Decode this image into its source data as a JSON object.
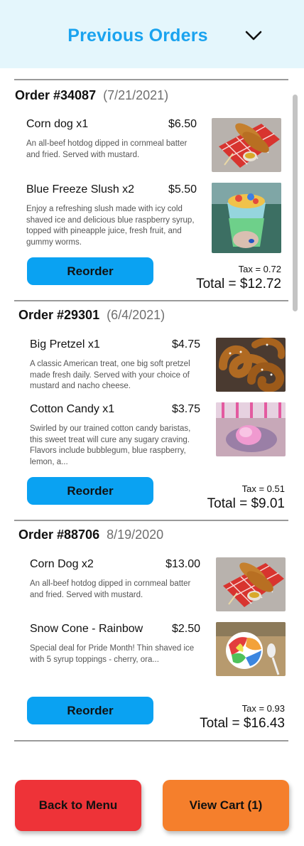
{
  "header": {
    "title": "Previous Orders",
    "toggle_icon": "chevron-down-icon"
  },
  "orders": [
    {
      "number": "Order #34087",
      "date": "(7/21/2021)",
      "items": [
        {
          "name": "Corn dog x1",
          "price": "$6.50",
          "description": "An all-beef hotdog dipped in cornmeal batter and fried. Served with mustard.",
          "image": "corn-dog-image"
        },
        {
          "name": "Blue Freeze Slush x2",
          "price": "$5.50",
          "description": "Enjoy a refreshing slush made with icy cold shaved ice and delicious blue raspberry syrup, topped with pineapple juice, fresh fruit, and gummy worms.",
          "image": "slush-image"
        }
      ],
      "reorder_label": "Reorder",
      "tax": "Tax = 0.72",
      "total": "Total = $12.72"
    },
    {
      "number": "Order #29301",
      "date": "(6/4/2021)",
      "items": [
        {
          "name": "Big Pretzel x1",
          "price": "$4.75",
          "description": "A classic American treat, one big soft pretzel made fresh daily. Served with your choice of mustard and nacho cheese.",
          "image": "pretzel-image"
        },
        {
          "name": "Cotton Candy x1",
          "price": "$3.75",
          "description": "Swirled by our trained cotton candy baristas, this sweet treat will cure any sugary craving. Flavors include bubblegum, blue raspberry, lemon, a...",
          "image": "cotton-candy-image"
        }
      ],
      "reorder_label": "Reorder",
      "tax": "Tax = 0.51",
      "total": "Total = $9.01"
    },
    {
      "number": "Order #88706",
      "date": "8/19/2020",
      "items": [
        {
          "name": "Corn Dog x2",
          "price": "$13.00",
          "description": "An all-beef hotdog dipped in cornmeal batter and fried. Served with mustard.",
          "image": "corn-dog-image"
        },
        {
          "name": "Snow Cone - Rainbow",
          "price": "$2.50",
          "description": "Special deal for Pride Month! Thin shaved ice with 5 syrup toppings - cherry, ora...",
          "image": "snow-cone-image"
        }
      ],
      "reorder_label": "Reorder",
      "tax": "Tax = 0.93",
      "total": "Total = $16.43"
    }
  ],
  "footer": {
    "back_label": "Back to Menu",
    "cart_label": "View Cart (1)"
  },
  "colors": {
    "header_bg": "#e4f6fc",
    "title": "#1aa3ef",
    "reorder": "#0aa2f2",
    "back": "#ee3338",
    "cart": "#f57f2c"
  }
}
